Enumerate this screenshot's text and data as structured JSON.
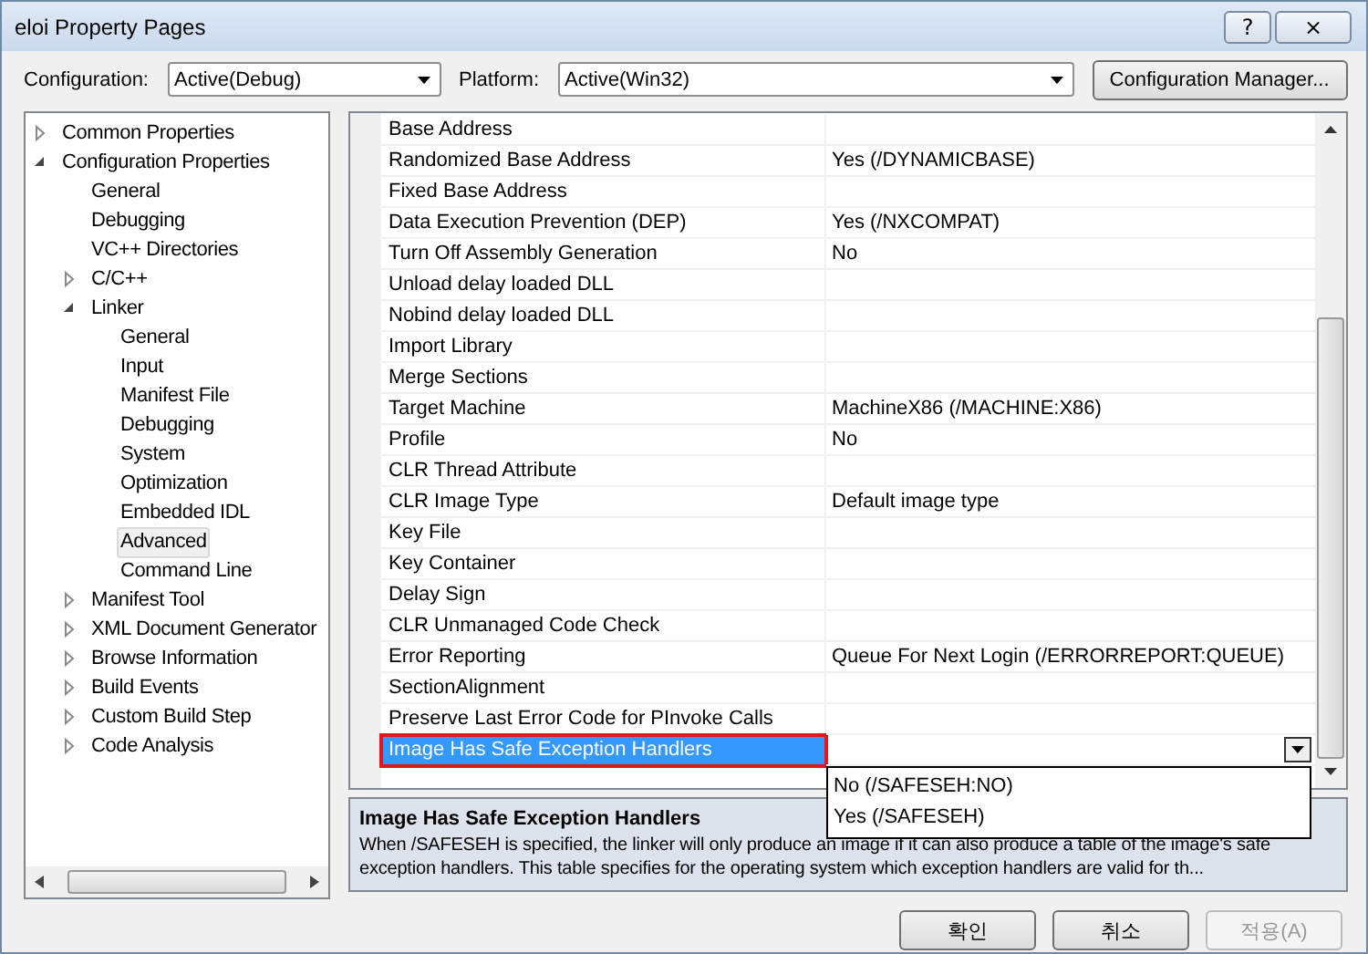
{
  "window": {
    "title": "eloi Property Pages",
    "buttons": [
      "?",
      "×"
    ]
  },
  "toolbar": {
    "configuration": {
      "label": "Configuration:",
      "value": "Active(Debug)"
    },
    "platform": {
      "label": "Platform:",
      "value": "Active(Win32)"
    },
    "manager_button": "Configuration Manager..."
  },
  "tree": {
    "items": [
      {
        "label": "Common Properties",
        "expanded": false,
        "selected": false
      },
      {
        "label": "Configuration Properties",
        "expanded": true,
        "selected": false,
        "children": [
          {
            "label": "General",
            "selected": false
          },
          {
            "label": "Debugging",
            "selected": false
          },
          {
            "label": "VC++ Directories",
            "selected": false
          },
          {
            "label": "C/C++",
            "expanded": false,
            "selected": false
          },
          {
            "label": "Linker",
            "expanded": true,
            "selected": false,
            "children": [
              {
                "label": "General",
                "selected": false
              },
              {
                "label": "Input",
                "selected": false
              },
              {
                "label": "Manifest File",
                "selected": false
              },
              {
                "label": "Debugging",
                "selected": false
              },
              {
                "label": "System",
                "selected": false
              },
              {
                "label": "Optimization",
                "selected": false
              },
              {
                "label": "Embedded IDL",
                "selected": false
              },
              {
                "label": "Advanced",
                "selected": true
              },
              {
                "label": "Command Line",
                "selected": false
              }
            ]
          },
          {
            "label": "Manifest Tool",
            "expanded": false,
            "selected": false
          },
          {
            "label": "XML Document Generator",
            "expanded": false,
            "selected": false
          },
          {
            "label": "Browse Information",
            "expanded": false,
            "selected": false
          },
          {
            "label": "Build Events",
            "expanded": false,
            "selected": false
          },
          {
            "label": "Custom Build Step",
            "expanded": false,
            "selected": false
          },
          {
            "label": "Code Analysis",
            "expanded": false,
            "selected": false
          }
        ]
      }
    ]
  },
  "grid": {
    "rows": [
      {
        "name": "Base Address",
        "selected": false
      },
      {
        "name": "Randomized Base Address",
        "value": "Yes (/DYNAMICBASE)",
        "selected": false
      },
      {
        "name": "Fixed Base Address",
        "selected": false
      },
      {
        "name": "Data Execution Prevention (DEP)",
        "value": "Yes (/NXCOMPAT)",
        "selected": false
      },
      {
        "name": "Turn Off Assembly Generation",
        "value": "No",
        "selected": false
      },
      {
        "name": "Unload delay loaded DLL",
        "selected": false
      },
      {
        "name": "Nobind delay loaded DLL",
        "selected": false
      },
      {
        "name": "Import Library",
        "selected": false
      },
      {
        "name": "Merge Sections",
        "selected": false
      },
      {
        "name": "Target Machine",
        "value": "MachineX86 (/MACHINE:X86)",
        "selected": false
      },
      {
        "name": "Profile",
        "value": "No",
        "selected": false
      },
      {
        "name": "CLR Thread Attribute",
        "selected": false
      },
      {
        "name": "CLR Image Type",
        "value": "Default image type",
        "selected": false
      },
      {
        "name": "Key File",
        "selected": false
      },
      {
        "name": "Key Container",
        "selected": false
      },
      {
        "name": "Delay Sign",
        "selected": false
      },
      {
        "name": "CLR Unmanaged Code Check",
        "selected": false
      },
      {
        "name": "Error Reporting",
        "value": "Queue For Next Login (/ERRORREPORT:QUEUE)",
        "selected": false
      },
      {
        "name": "SectionAlignment",
        "selected": false
      },
      {
        "name": "Preserve Last Error Code for PInvoke Calls",
        "selected": false
      },
      {
        "name": "Image Has Safe Exception Handlers",
        "selected": true
      }
    ],
    "dropdown": {
      "options": [
        "No (/SAFESEH:NO)",
        "Yes (/SAFESEH)"
      ]
    }
  },
  "description": {
    "title": "Image Has Safe Exception Handlers",
    "text": "When /SAFESEH is specified, the linker will only produce an image if it can also produce a table of the image's safe exception handlers. This table specifies for the operating system which exception handlers are valid for th..."
  },
  "buttons": [
    {
      "label": "확인",
      "disabled": false
    },
    {
      "label": "취소",
      "disabled": false
    },
    {
      "label": "적용(A)",
      "disabled": true
    }
  ]
}
